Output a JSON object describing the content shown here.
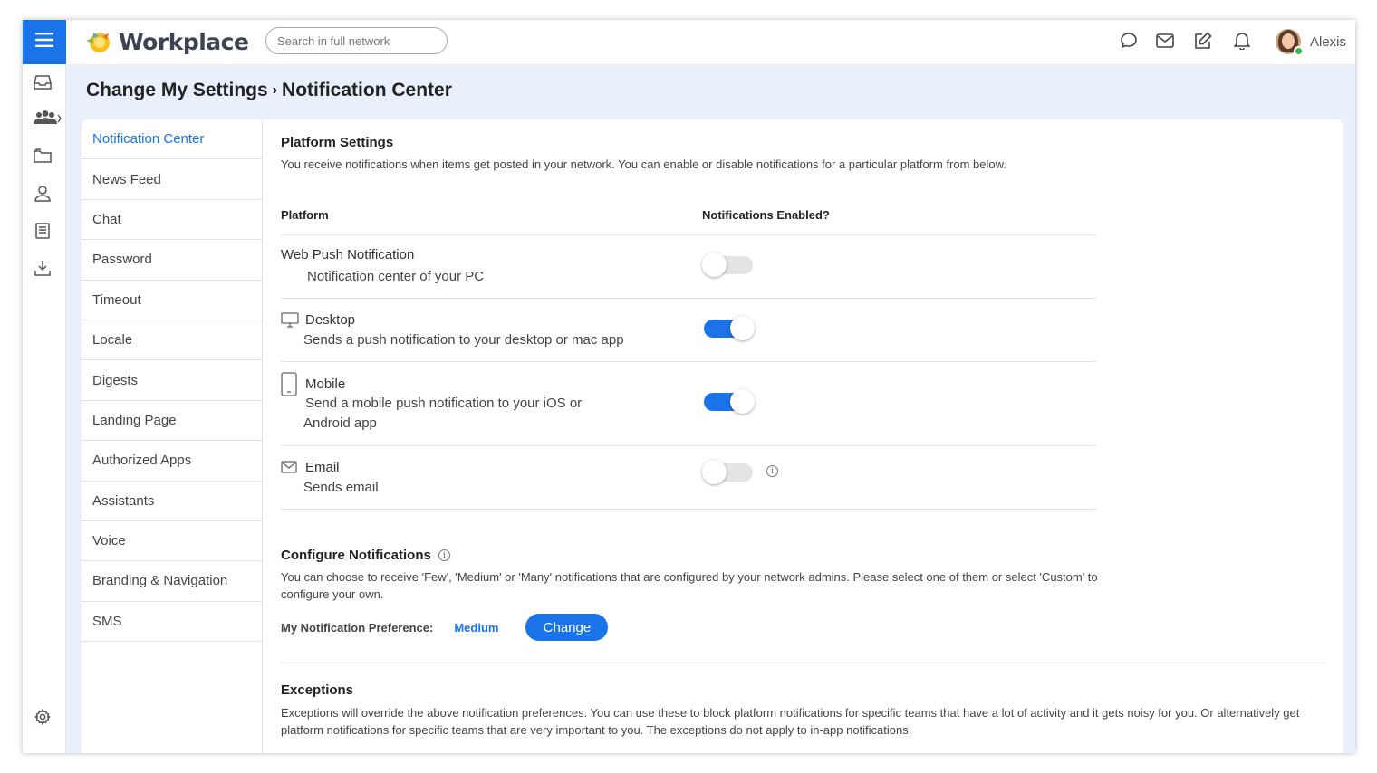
{
  "app": {
    "name": "Workplace",
    "accent": "#1a73e8"
  },
  "search": {
    "placeholder": "Search in full network"
  },
  "topbar": {
    "icons": [
      "chat-bubble-icon",
      "mail-icon",
      "compose-icon",
      "bell-icon"
    ]
  },
  "user": {
    "name": "Alexis",
    "status": "online"
  },
  "rail": {
    "icons": [
      "menu-icon",
      "inbox-icon",
      "groups-icon",
      "folder-icon",
      "profile-icon",
      "book-icon",
      "download-icon",
      "settings-icon"
    ]
  },
  "breadcrumb": {
    "parent": "Change My Settings",
    "separator": "›",
    "current": "Notification Center"
  },
  "settings_menu": {
    "items": [
      {
        "label": "Notification Center",
        "active": true
      },
      {
        "label": "News Feed"
      },
      {
        "label": "Chat"
      },
      {
        "label": "Password"
      },
      {
        "label": "Timeout"
      },
      {
        "label": "Locale"
      },
      {
        "label": "Digests"
      },
      {
        "label": "Landing Page"
      },
      {
        "label": "Authorized Apps"
      },
      {
        "label": "Assistants"
      },
      {
        "label": "Voice"
      },
      {
        "label": "Branding & Navigation"
      },
      {
        "label": "SMS"
      }
    ]
  },
  "platform_settings": {
    "title": "Platform Settings",
    "description": "You receive notifications when items get posted in your network. You can enable or disable notifications for a particular platform from below.",
    "columns": {
      "platform": "Platform",
      "enabled": "Notifications Enabled?"
    },
    "rows": [
      {
        "title": "Web Push Notification",
        "subtitle": "Notification center of your PC",
        "icon": "none",
        "enabled": false
      },
      {
        "title": "Desktop",
        "subtitle": "Sends a push notification to your desktop or mac app",
        "icon": "desktop-icon",
        "enabled": true
      },
      {
        "title": "Mobile",
        "subtitle_line1": "Send a mobile push notification to your iOS or",
        "subtitle_line2": "Android app",
        "icon": "mobile-icon",
        "enabled": true
      },
      {
        "title": "Email",
        "subtitle": "Sends email",
        "icon": "mail-icon",
        "enabled": false,
        "has_info": true
      }
    ]
  },
  "configure": {
    "title": "Configure Notifications",
    "description": "You can choose to receive 'Few', 'Medium' or 'Many' notifications that are configured by your network admins. Please select one of them or select 'Custom' to configure your own.",
    "preference_label": "My Notification Preference:",
    "preference_value": "Medium",
    "change_label": "Change"
  },
  "exceptions": {
    "title": "Exceptions",
    "description": "Exceptions will override the above notification preferences. You can use these to block platform notifications for specific teams that have a lot of activity and it gets noisy for you. Or alternatively get platform notifications for specific teams that are very important to you. The exceptions do not apply to in-app notifications."
  }
}
